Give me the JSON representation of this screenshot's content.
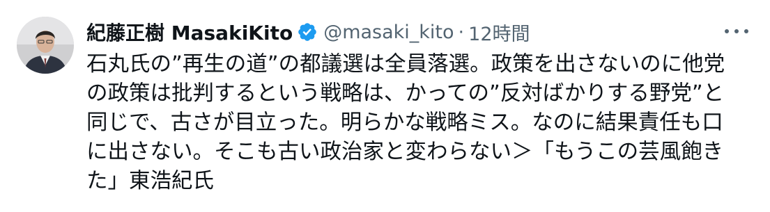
{
  "author": {
    "display_name": "紀藤正樹 MasakiKito",
    "handle": "@masaki_kito",
    "separator": "·",
    "timestamp": "12時間",
    "verified_icon": "verified-badge-icon",
    "avatar_icon": "profile-photo"
  },
  "menu": {
    "icon": "more-options-icon"
  },
  "tweet": {
    "lines": [
      "石丸氏の”再生の道”の都議選は全員落選。政策を出さないのに他党",
      "の政策は批判するという戦略は、かっての”反対ばかりする野党”と",
      "同じで、古さが目立った。明らかな戦略ミス。なのに結果責任も口",
      "に出さない。そこも古い政治家と変わらない＞「もうこの芸風飽き",
      "た」東浩紀氏"
    ]
  },
  "colors": {
    "text": "#0f1419",
    "secondary": "#536471",
    "verified": "#1d9bf0"
  }
}
